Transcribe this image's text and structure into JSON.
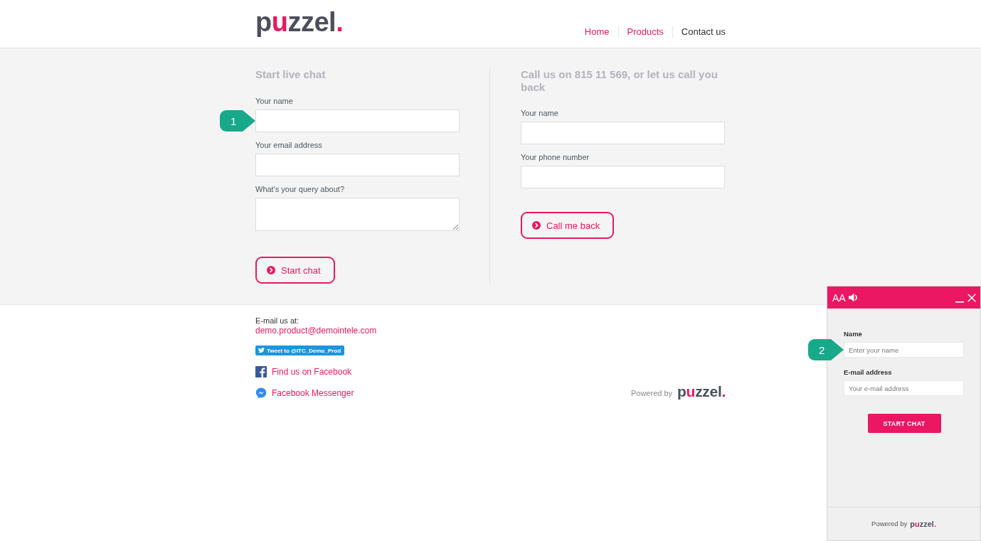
{
  "header": {
    "logo": "puzzel.",
    "nav": [
      {
        "label": "Home",
        "selected": false
      },
      {
        "label": "Products",
        "selected": false
      },
      {
        "label": "Contact us",
        "selected": true
      }
    ]
  },
  "live_chat": {
    "title": "Start live chat",
    "fields": [
      {
        "kind": "input",
        "label": "Your name",
        "callout": "1"
      },
      {
        "kind": "input",
        "label": "Your email address"
      },
      {
        "kind": "textarea",
        "label": "What's your query about?"
      }
    ],
    "button": "Start chat"
  },
  "callback": {
    "title": "Call us on 815 11 569, or let us call you back",
    "fields": [
      {
        "kind": "input",
        "label": "Your name"
      },
      {
        "kind": "input",
        "label": "Your phone number"
      }
    ],
    "button": "Call me back"
  },
  "footer": {
    "email_label": "E-mail us at:",
    "email": "demo.product@demointele.com",
    "tweet_button": "Tweet to @ITC_Demo_Prod",
    "links": [
      {
        "kind": "facebook",
        "label": "Find us on Facebook"
      },
      {
        "kind": "messenger",
        "label": "Facebook Messenger"
      }
    ],
    "powered_by": "Powered by",
    "logo": "puzzel."
  },
  "chat_widget": {
    "text_size_button": "AA",
    "fields": [
      {
        "label": "Name",
        "placeholder": "Enter your name",
        "callout": "2"
      },
      {
        "label": "E-mail address",
        "placeholder": "Your e-mail address"
      }
    ],
    "button": "START CHAT",
    "powered_by": "Powered by",
    "logo": "puzzel."
  }
}
